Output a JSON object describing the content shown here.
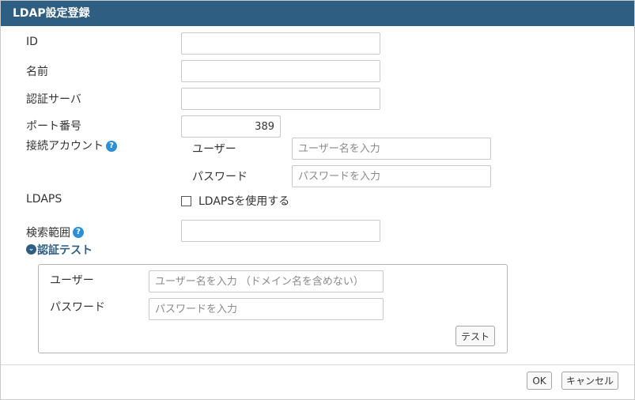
{
  "dialog": {
    "title": "LDAP設定登録"
  },
  "fields": {
    "id": {
      "label": "ID",
      "value": ""
    },
    "name": {
      "label": "名前",
      "value": ""
    },
    "auth_server": {
      "label": "認証サーバ",
      "value": ""
    },
    "port": {
      "label": "ポート番号",
      "value": "389"
    },
    "account": {
      "label": "接続アカウント",
      "user_label": "ユーザー",
      "user_placeholder": "ユーザー名を入力",
      "password_label": "パスワード",
      "password_placeholder": "パスワードを入力"
    },
    "ldaps": {
      "label": "LDAPS",
      "checkbox_label": "LDAPSを使用する",
      "checked": false
    },
    "search_scope": {
      "label": "検索範囲",
      "value": ""
    }
  },
  "auth_test": {
    "title": "認証テスト",
    "user_label": "ユーザー",
    "user_placeholder": "ユーザー名を入力 （ドメイン名を含めない）",
    "password_label": "パスワード",
    "password_placeholder": "パスワードを入力",
    "test_button": "テスト"
  },
  "footer": {
    "ok": "OK",
    "cancel": "キャンセル"
  },
  "icons": {
    "help": "question-circle-icon",
    "collapse": "chevron-down-circle-icon"
  },
  "colors": {
    "title_bar": "#2e5e82",
    "help": "#2d8fd6"
  }
}
